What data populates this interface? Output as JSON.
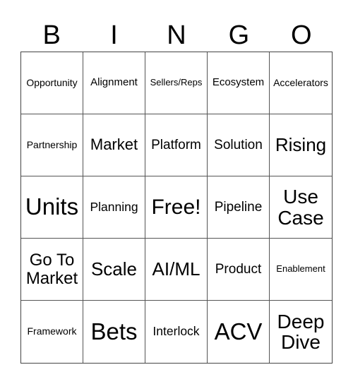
{
  "header": [
    "B",
    "I",
    "N",
    "G",
    "O"
  ],
  "cells": [
    "Opportunity",
    "Alignment",
    "Sellers/Reps",
    "Ecosystem",
    "Accelerators",
    "Partnership",
    "Market",
    "Platform",
    "Solution",
    "Rising",
    "Units",
    "Planning",
    "Free!",
    "Pipeline",
    "Use Case",
    "Go To Market",
    "Scale",
    "AI/ML",
    "Product",
    "Enablement",
    "Framework",
    "Bets",
    "Interlock",
    "ACV",
    "Deep Dive"
  ]
}
